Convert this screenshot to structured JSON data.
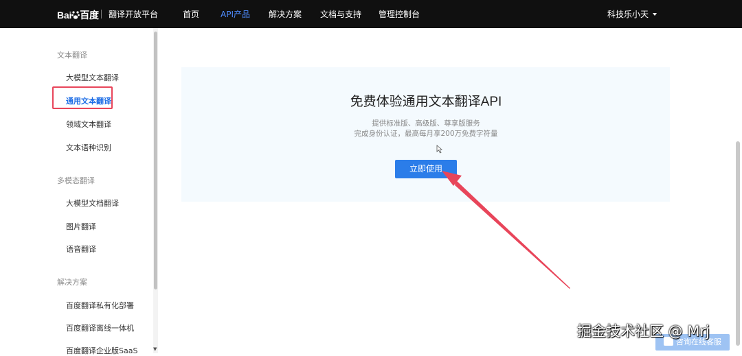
{
  "header": {
    "logo_text": "Bai",
    "logo_text2": "百度",
    "subtitle": "翻译开放平台",
    "nav": [
      "首页",
      "API产品",
      "解决方案",
      "文档与支持",
      "管理控制台"
    ],
    "active_nav": "API产品",
    "user": "科技乐小天"
  },
  "sidebar": {
    "groups": [
      {
        "title": "文本翻译",
        "items": [
          "大模型文本翻译",
          "通用文本翻译",
          "领域文本翻译",
          "文本语种识别"
        ]
      },
      {
        "title": "多模态翻译",
        "items": [
          "大模型文档翻译",
          "图片翻译",
          "语音翻译"
        ]
      },
      {
        "title": "解决方案",
        "items": [
          "百度翻译私有化部署",
          "百度翻译离线一体机",
          "百度翻译企业版SaaS"
        ]
      }
    ],
    "active_item": "通用文本翻译"
  },
  "main": {
    "title": "免费体验通用文本翻译API",
    "subtitle1": "提供标准版、高级版、尊享版服务",
    "subtitle2": "完成身份认证，最高每月享200万免费字符量",
    "button": "立即使用"
  },
  "chat_button": "咨询在线客服",
  "watermark": "掘金技术社区 @ Mrj",
  "colors": {
    "accent": "#2b7de9",
    "highlight": "#e8455a",
    "nav_bg": "#101010",
    "card_bg": "#f4fafe"
  }
}
